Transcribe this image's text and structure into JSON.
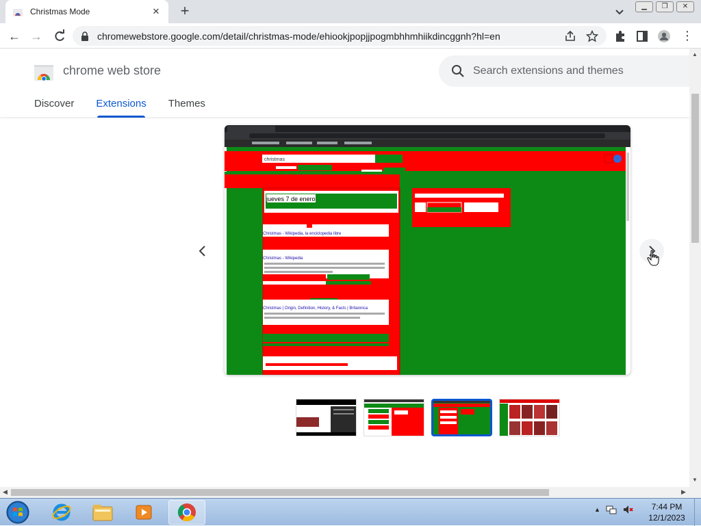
{
  "browser": {
    "tab_title": "Christmas Mode",
    "tab_close": "✕",
    "new_tab": "+",
    "url": "chromewebstore.google.com/detail/christmas-mode/ehiookjpopjjpogmbhhmhiikdincggnh?hl=en"
  },
  "store": {
    "name": "chrome web store",
    "search_placeholder": "Search extensions and themes",
    "tabs": [
      {
        "label": "Discover",
        "active": false
      },
      {
        "label": "Extensions",
        "active": true
      },
      {
        "label": "Themes",
        "active": false
      }
    ]
  },
  "gallery": {
    "selected_index": 2,
    "thumbnail_count": 4
  },
  "screenshot_content": {
    "search_query": "christmas",
    "date_box": "jueves 7 de enero",
    "results": [
      {
        "title": "Christmas - Wikipedia, la enciclopedia libre"
      },
      {
        "title": "Christmas - Wikipedia"
      },
      {
        "title": "Christmas | Origin, Definition, History, & Facts | Britannica"
      }
    ]
  },
  "taskbar": {
    "time": "7:44 PM",
    "date": "12/1/2023"
  },
  "colors": {
    "accent": "#0b57d0",
    "christmas_red": "#ff0000",
    "christmas_green": "#0d8a16"
  }
}
